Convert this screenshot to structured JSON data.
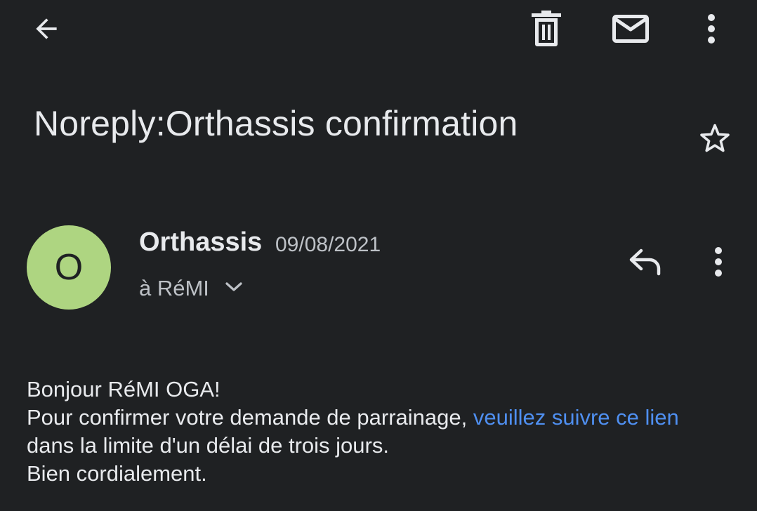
{
  "toolbar": {
    "back_icon": "arrow-back-icon",
    "delete_icon": "trash-icon",
    "mark_unread_icon": "mail-envelope-icon",
    "more_icon": "more-vertical-icon"
  },
  "email": {
    "subject": "Noreply:Orthassis confirmation",
    "star_icon": "star-outline-icon",
    "sender": {
      "avatar_letter": "O",
      "avatar_color": "#aed581",
      "name": "Orthassis",
      "date": "09/08/2021",
      "recipient": "à RéMI",
      "expand_icon": "chevron-down-icon"
    },
    "actions": {
      "reply_icon": "reply-icon",
      "more_icon": "more-vertical-icon"
    },
    "body": {
      "greeting": "Bonjour RéMI OGA!",
      "line1_before_link": "Pour confirmer votre demande de parrainage, ",
      "link_text": "veuillez suivre ce lien",
      "line1_after_link": " dans la limite d'un délai de trois jours.",
      "closing": "Bien cordialement."
    }
  },
  "colors": {
    "background": "#1f2123",
    "text_primary": "#e8eaed",
    "text_secondary": "#bdc1c6",
    "link": "#4f8ff0"
  }
}
